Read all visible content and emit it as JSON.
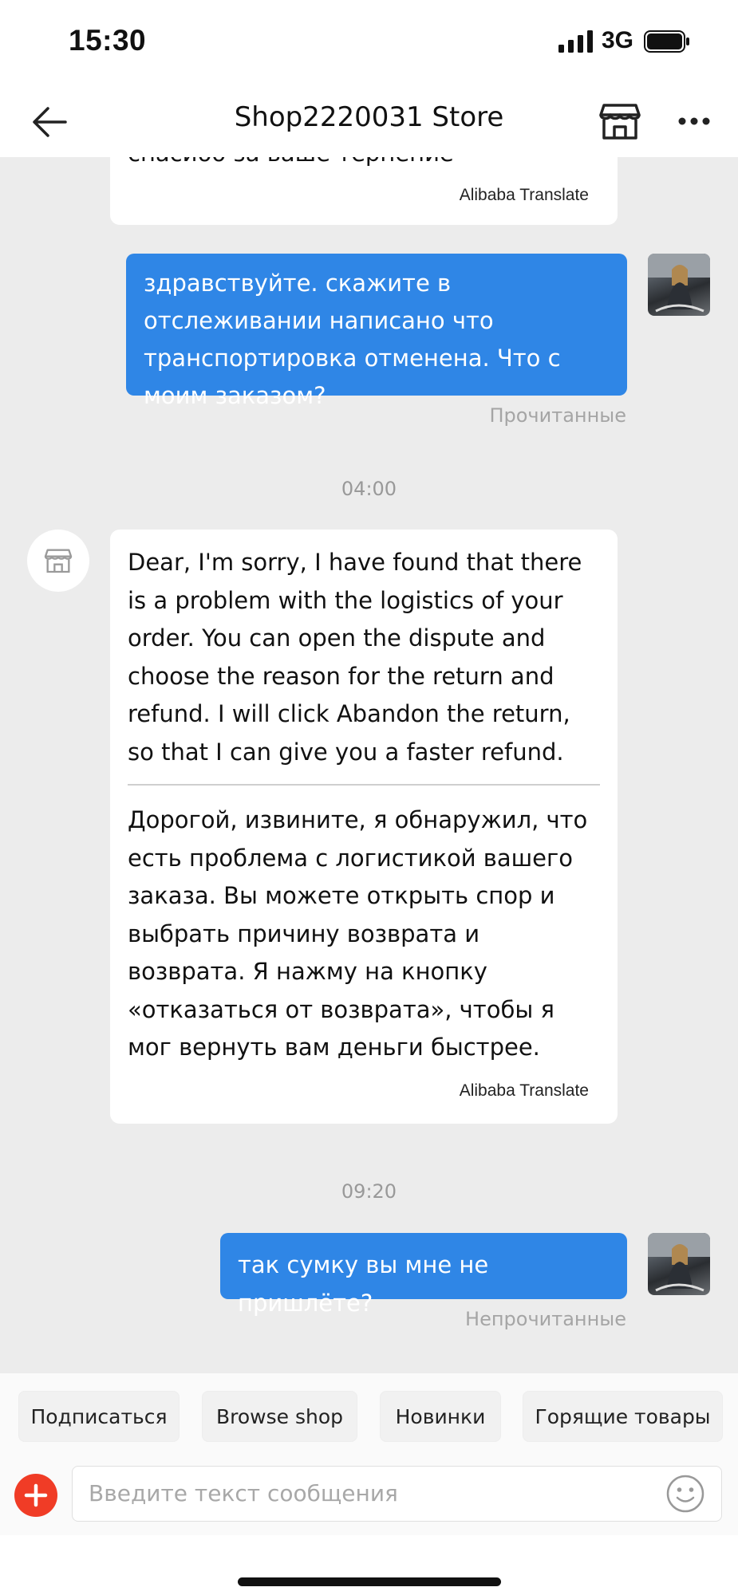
{
  "status_bar": {
    "time": "15:30",
    "network": "3G"
  },
  "header": {
    "title": "Shop2220031 Store"
  },
  "messages": {
    "partial_incoming": {
      "text": "спасибо за ваше терпение",
      "translate_label": "Alibaba Translate"
    },
    "outgoing_1": {
      "text": "здравствуйте. скажите в отслеживании написано что транспортировка отменена.  Что с моим заказом?",
      "status": "Прочитанные"
    },
    "timestamp_1": "04:00",
    "incoming_1": {
      "original": "Dear, I'm sorry, I have found that there is a problem with the logistics of your order. You can open the dispute and choose the reason for the return and refund. I will click Abandon the return, so that I can give you a faster refund.",
      "translation": "Дорогой, извините, я обнаружил, что есть проблема с логистикой вашего заказа. Вы можете открыть спор и выбрать причину возврата и возврата. Я нажму на кнопку «отказаться от возврата», чтобы я мог вернуть вам деньги быстрее.",
      "translate_label": "Alibaba Translate"
    },
    "timestamp_2": "09:20",
    "outgoing_2": {
      "text": "так сумку вы мне не пришлёте?",
      "status": "Непрочитанные"
    }
  },
  "quick_replies": [
    "Подписаться",
    "Browse shop",
    "Новинки",
    "Горящие товары"
  ],
  "input": {
    "placeholder": "Введите текст сообщения",
    "value": ""
  },
  "colors": {
    "outgoing_bubble": "#2f86e6",
    "chat_background": "#ececec",
    "plus_button": "#f03c26"
  },
  "icons": {
    "back": "arrow-left-icon",
    "store": "storefront-icon",
    "more": "more-horizontal-icon",
    "plus": "plus-icon",
    "emoji": "smiley-icon"
  }
}
